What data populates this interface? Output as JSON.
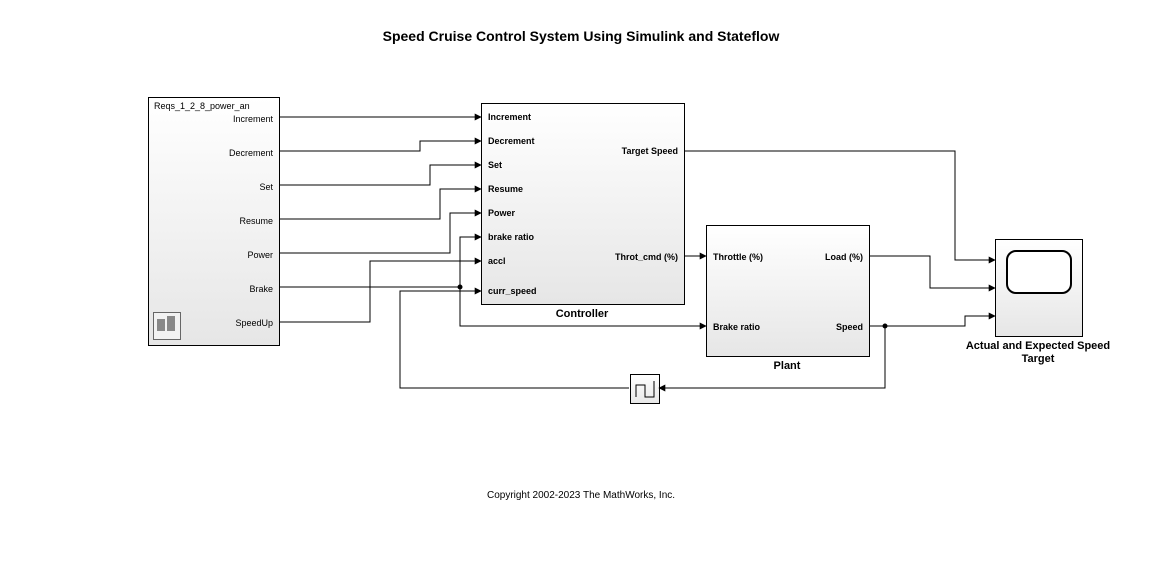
{
  "title": "Speed Cruise Control System Using Simulink and Stateflow",
  "copyright": "Copyright 2002-2023 The MathWorks, Inc.",
  "source_block": {
    "title": "Reqs_1_2_8_power_an",
    "outputs": [
      "Increment",
      "Decrement",
      "Set",
      "Resume",
      "Power",
      "Brake",
      "SpeedUp"
    ]
  },
  "controller": {
    "label": "Controller",
    "inputs": [
      "Increment",
      "Decrement",
      "Set",
      "Resume",
      "Power",
      "brake ratio",
      "accl",
      "curr_speed"
    ],
    "outputs": {
      "target_speed": "Target Speed",
      "throt_cmd": "Throt_cmd (%)"
    }
  },
  "plant": {
    "label": "Plant",
    "inputs": {
      "throttle": "Throttle (%)",
      "brake_ratio": "Brake ratio"
    },
    "outputs": {
      "load": "Load (%)",
      "speed": "Speed"
    }
  },
  "scope": {
    "label": "Actual and Expected Speed Target"
  }
}
